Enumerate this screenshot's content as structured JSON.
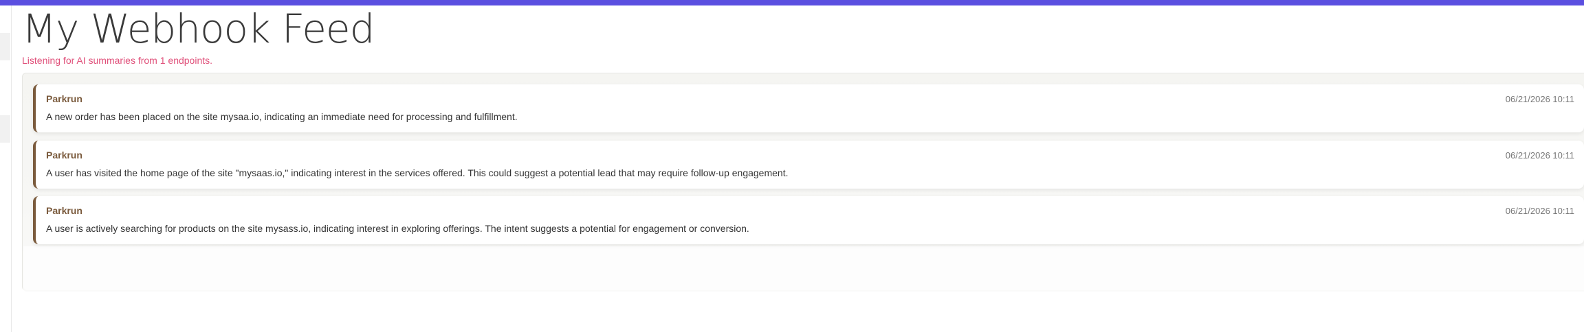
{
  "app": {
    "accent_color": "#5b4fe0"
  },
  "header": {
    "title": "My Webhook Feed",
    "subtitle": "Listening for AI summaries from 1 endpoints."
  },
  "colors": {
    "subtitle": "#e0507a",
    "card_accent": "#7a5a3c"
  },
  "feed": {
    "items": [
      {
        "source": "Parkrun",
        "timestamp": "06/21/2026 10:11",
        "summary": "A new order has been placed on the site mysaa.io, indicating an immediate need for processing and fulfillment."
      },
      {
        "source": "Parkrun",
        "timestamp": "06/21/2026 10:11",
        "summary": "A user has visited the home page of the site \"mysaas.io,\" indicating interest in the services offered. This could suggest a potential lead that may require follow-up engagement."
      },
      {
        "source": "Parkrun",
        "timestamp": "06/21/2026 10:11",
        "summary": "A user is actively searching for products on the site mysass.io, indicating interest in exploring offerings. The intent suggests a potential for engagement or conversion."
      }
    ]
  }
}
